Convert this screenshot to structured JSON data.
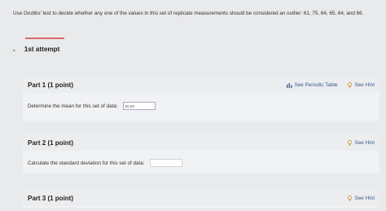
{
  "question": {
    "text": "Use Grubbs' test to decide whether any one of the values in this set of replicate measurements should be considered an outlier: 61, 75, 64, 65, 64, and 66."
  },
  "attempt": {
    "title": "1st attempt"
  },
  "parts": [
    {
      "title": "Part 1  (1 point)",
      "prompt": "Determine the mean for this set of data:",
      "answer": "65.83",
      "periodic_table_label": "See Periodic Table",
      "hint_label": "See Hint"
    },
    {
      "title": "Part 2  (1 point)",
      "prompt": "Calculate the standard deviation for this set of data:",
      "answer": "",
      "hint_label": "See Hint"
    },
    {
      "title": "Part 3  (1 point)",
      "hint_label": "See Hint"
    }
  ],
  "colors": {
    "accent_rule": "#d9534f",
    "link": "#3a5a8f"
  }
}
